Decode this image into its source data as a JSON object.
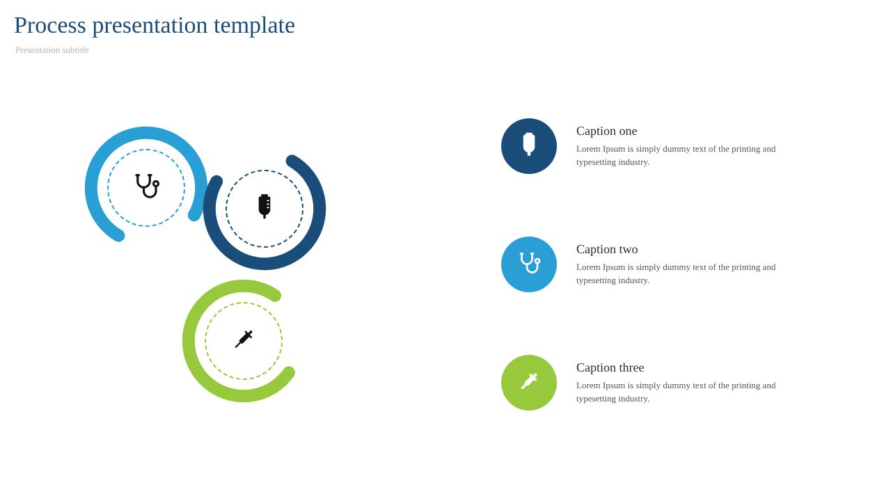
{
  "header": {
    "title": "Process presentation template",
    "subtitle": "Presentation subtitle"
  },
  "colors": {
    "blue_light": "#2a9fd6",
    "blue_dark": "#1a4d7a",
    "green": "#97c93d"
  },
  "diagram": {
    "nodes": [
      {
        "icon": "stethoscope",
        "ring_color_ref": "blue_light",
        "dashed_color_ref": "blue_light"
      },
      {
        "icon": "iv-bag",
        "ring_color_ref": "blue_dark",
        "dashed_color_ref": "blue_dark"
      },
      {
        "icon": "syringe",
        "ring_color_ref": "green",
        "dashed_color_ref": "green"
      }
    ]
  },
  "captions": [
    {
      "icon": "iv-bag",
      "color_ref": "blue_dark",
      "title": "Caption one",
      "body": "Lorem Ipsum is simply dummy text of the printing and typesetting industry."
    },
    {
      "icon": "stethoscope",
      "color_ref": "blue_light",
      "title": "Caption two",
      "body": "Lorem Ipsum is simply dummy text of the printing and typesetting industry."
    },
    {
      "icon": "syringe",
      "color_ref": "green",
      "title": "Caption three",
      "body": "Lorem Ipsum is simply dummy text of the printing and typesetting industry."
    }
  ]
}
